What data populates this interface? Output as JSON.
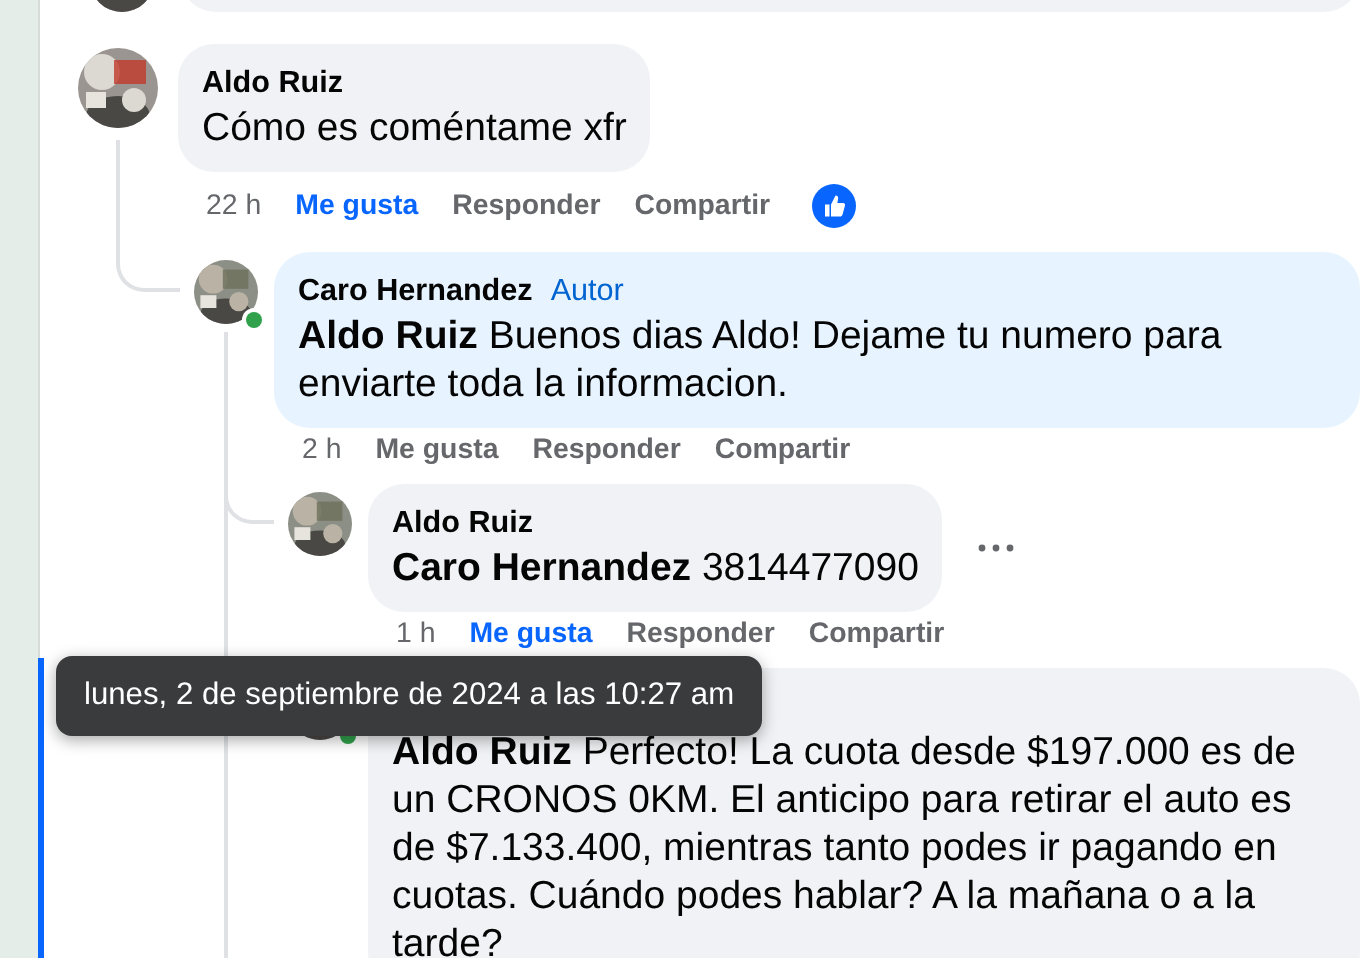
{
  "comments": [
    {
      "author": "Aldo Ruiz",
      "online": false,
      "text": "Cómo es coméntame xfr",
      "time": "22 h",
      "actions": [
        "Me gusta",
        "Responder",
        "Compartir"
      ],
      "liked": true,
      "reacted": true,
      "more_menu": false,
      "highlighted": false,
      "children": [
        {
          "author": "Caro Hernandez",
          "author_badge": "Autor",
          "online": true,
          "author_reply": true,
          "text": "**Aldo Ruiz** Buenos dias Aldo! Dejame tu numero para enviarte toda la informacion.",
          "time": "2 h",
          "actions": [
            "Me gusta",
            "Responder",
            "Compartir"
          ],
          "liked": false,
          "reacted": false,
          "more_menu": false,
          "highlighted": false,
          "children": [
            {
              "author": "Aldo Ruiz",
              "online": false,
              "author_reply": false,
              "text": "**Caro Hernandez** 3814477090",
              "time": "1 h",
              "actions": [
                "Me gusta",
                "Responder",
                "Compartir"
              ],
              "liked": true,
              "reacted": false,
              "more_menu": true,
              "highlighted": false
            },
            {
              "online": true,
              "author_reply": false,
              "text": "**Aldo Ruiz** Perfecto! La cuota desde $197.000 es de un CRONOS 0KM. El anticipo para retirar el auto es de $7.133.400, mientras tanto podes ir pagando en cuotas. Cuándo podes hablar? A la mañana o a la tarde?",
              "reacted": false,
              "more_menu": false,
              "highlighted": true
            }
          ]
        }
      ]
    }
  ],
  "tooltip": {
    "text": "lunes, 2 de septiembre de 2024 a las 10:27 am"
  }
}
